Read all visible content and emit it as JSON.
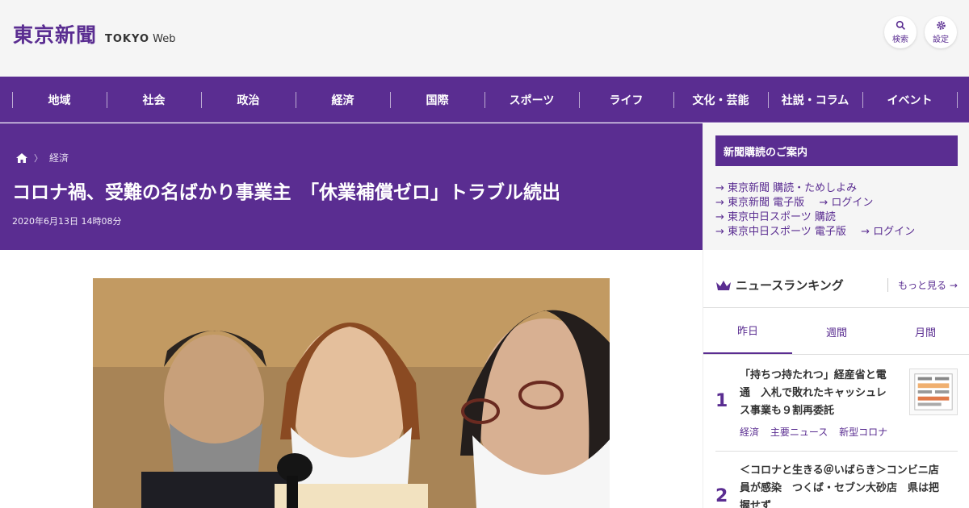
{
  "header": {
    "logo_ja": "東京新聞",
    "logo_en_bold": "TOKYO",
    "logo_en_light": "Web",
    "search_label": "検索",
    "settings_label": "設定"
  },
  "nav": {
    "items": [
      "地域",
      "社会",
      "政治",
      "経済",
      "国際",
      "スポーツ",
      "ライフ",
      "文化・芸能",
      "社説・コラム",
      "イベント"
    ]
  },
  "article": {
    "breadcrumb_category": "経済",
    "breadcrumb_separator": "〉",
    "title": "コロナ禍、受難の名ばかり事業主　「休業補償ゼロ」トラブル続出",
    "date": "2020年6月13日 14時08分"
  },
  "sidebar": {
    "subscription_heading": "新聞購読のご案内",
    "links": {
      "row1": "東京新聞 購読・ためしよみ",
      "row2a": "東京新聞 電子版",
      "row2b": "ログイン",
      "row3": "東京中日スポーツ 購読",
      "row4a": "東京中日スポーツ 電子版",
      "row4b": "ログイン",
      "arrow": "→"
    },
    "ranking_title": "ニュースランキング",
    "more_label": "もっと見る",
    "tabs": [
      "昨日",
      "週間",
      "月間"
    ],
    "ranking": [
      {
        "rank": "1",
        "title_line1": "「持ちつ持たれつ」経産省と電",
        "title_line2": "通　入札で敗れたキャッシュレ",
        "title_line3": "ス事業も９割再委託",
        "tags": [
          "経済",
          "主要ニュース",
          "新型コロナ"
        ]
      },
      {
        "rank": "2",
        "title_line1": "＜コロナと生きる＠いばらき＞コンビニ店",
        "title_line2": "員が感染　つくば・セブン大砂店　県は把",
        "title_line3": "握せず"
      }
    ]
  },
  "colors": {
    "brand": "#5a2d91",
    "header_bg": "#f5f5f5"
  }
}
